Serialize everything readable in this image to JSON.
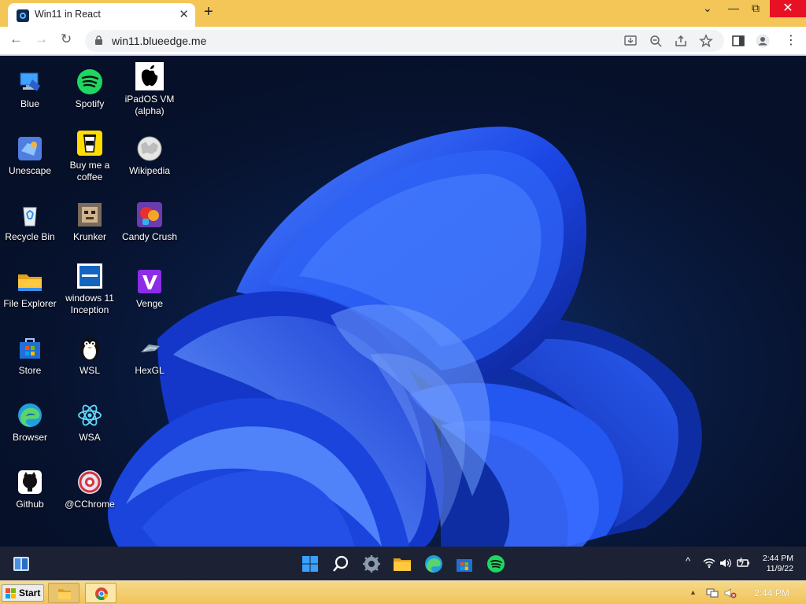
{
  "browser": {
    "tab_title": "Win11 in React",
    "new_tab": "+",
    "url": "win11.blueedge.me",
    "icons": [
      "back-icon",
      "forward-icon",
      "reload-icon",
      "lock-icon",
      "install-icon",
      "zoom-icon",
      "share-icon",
      "bookmark-star-icon",
      "sidebar-icon",
      "profile-icon",
      "menu-icon"
    ]
  },
  "desktop": {
    "col1": [
      {
        "label": "Blue",
        "icon": "blue-computer-icon"
      },
      {
        "label": "Unescape",
        "icon": "unescape-icon"
      },
      {
        "label": "Recycle Bin",
        "icon": "recycle-bin-icon"
      },
      {
        "label": "File Explorer",
        "icon": "folder-icon"
      },
      {
        "label": "Store",
        "icon": "store-icon"
      },
      {
        "label": "Browser",
        "icon": "edge-icon"
      },
      {
        "label": "Github",
        "icon": "github-icon"
      }
    ],
    "col2": [
      {
        "label": "Spotify",
        "icon": "spotify-icon"
      },
      {
        "label": "Buy me a coffee",
        "icon": "coffee-icon"
      },
      {
        "label": "Krunker",
        "icon": "krunker-icon"
      },
      {
        "label": "windows 11 Inception",
        "icon": "windows-inception-icon"
      },
      {
        "label": "WSL",
        "icon": "penguin-icon"
      },
      {
        "label": "WSA",
        "icon": "atom-icon"
      },
      {
        "label": "@CChrome",
        "icon": "cchrome-icon"
      }
    ],
    "col3": [
      {
        "label": "iPadOS VM (alpha)",
        "icon": "apple-icon"
      },
      {
        "label": "Wikipedia",
        "icon": "wikipedia-icon"
      },
      {
        "label": "Candy Crush",
        "icon": "candy-crush-icon"
      },
      {
        "label": "Venge",
        "icon": "venge-icon"
      },
      {
        "label": "HexGL",
        "icon": "hexgl-icon"
      }
    ]
  },
  "taskbar": {
    "time": "2:44 PM",
    "date": "11/9/22",
    "apps": [
      "widgets-icon",
      "start-icon",
      "search-icon",
      "settings-icon",
      "file-explorer-icon",
      "edge-icon",
      "store-icon",
      "spotify-icon"
    ]
  },
  "host": {
    "start_label": "Start",
    "time": "2:44 PM"
  }
}
